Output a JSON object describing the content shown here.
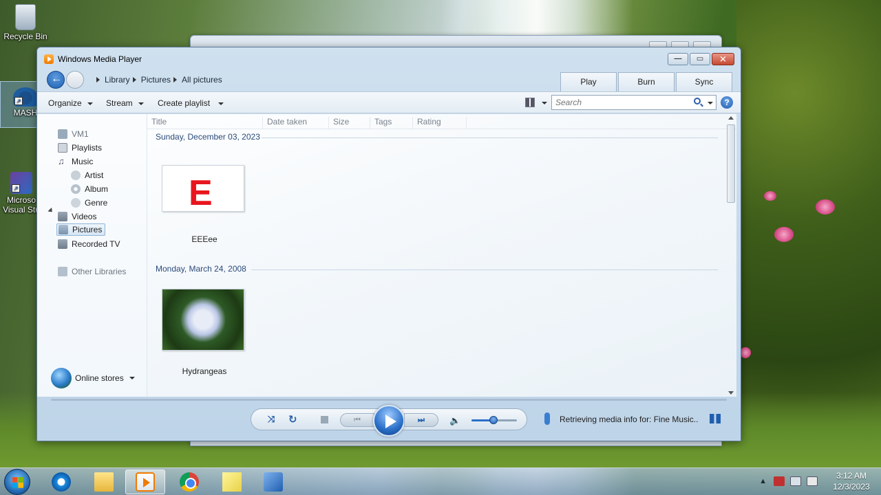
{
  "desktop": {
    "icons": [
      {
        "label": "Recycle Bin"
      },
      {
        "label": "MASH"
      },
      {
        "label": "Microso Visual Stu"
      }
    ]
  },
  "window": {
    "title": "Windows Media Player",
    "breadcrumb": [
      "Library",
      "Pictures",
      "All pictures"
    ],
    "tabs": [
      "Play",
      "Burn",
      "Sync"
    ],
    "toolbar": {
      "organize": "Organize",
      "stream": "Stream",
      "create_playlist": "Create playlist"
    },
    "search": {
      "placeholder": "Search"
    },
    "help_glyph": "?"
  },
  "nav": {
    "items": [
      {
        "label": "VM1",
        "icon": "vm-icon"
      },
      {
        "label": "Playlists",
        "icon": "playlist-icon"
      },
      {
        "label": "Music",
        "icon": "music-icon"
      },
      {
        "label": "Artist",
        "icon": "artist-icon"
      },
      {
        "label": "Album",
        "icon": "album-icon"
      },
      {
        "label": "Genre",
        "icon": "genre-icon"
      },
      {
        "label": "Videos",
        "icon": "videos-icon"
      },
      {
        "label": "Pictures",
        "icon": "pictures-icon",
        "selected": true
      },
      {
        "label": "Recorded TV",
        "icon": "tv-icon"
      },
      {
        "label": "Other Libraries",
        "icon": "other-libraries-icon"
      }
    ],
    "online_stores": "Online stores"
  },
  "columns": [
    "Title",
    "Date taken",
    "Size",
    "Tags",
    "Rating"
  ],
  "groups": [
    {
      "date": "Sunday, December 03, 2023",
      "items": [
        {
          "title": "EEEee",
          "thumb_text": "E"
        }
      ]
    },
    {
      "date": "Monday, March 24, 2008",
      "items": [
        {
          "title": "Hydrangeas"
        }
      ]
    }
  ],
  "player": {
    "volume_level": 0.48,
    "status": "Retrieving media info for: Fine Music.."
  },
  "taskbar": {
    "apps": [
      "internet-explorer",
      "windows-explorer",
      "windows-media-player",
      "chrome",
      "sticky-notes",
      "network-tool"
    ],
    "active_app": "windows-media-player",
    "time": "3:12 AM",
    "date": "12/3/2023"
  },
  "colors": {
    "accent_blue": "#1f5fb0",
    "close_red": "#c54a33",
    "thumb_red": "#e8161e"
  }
}
